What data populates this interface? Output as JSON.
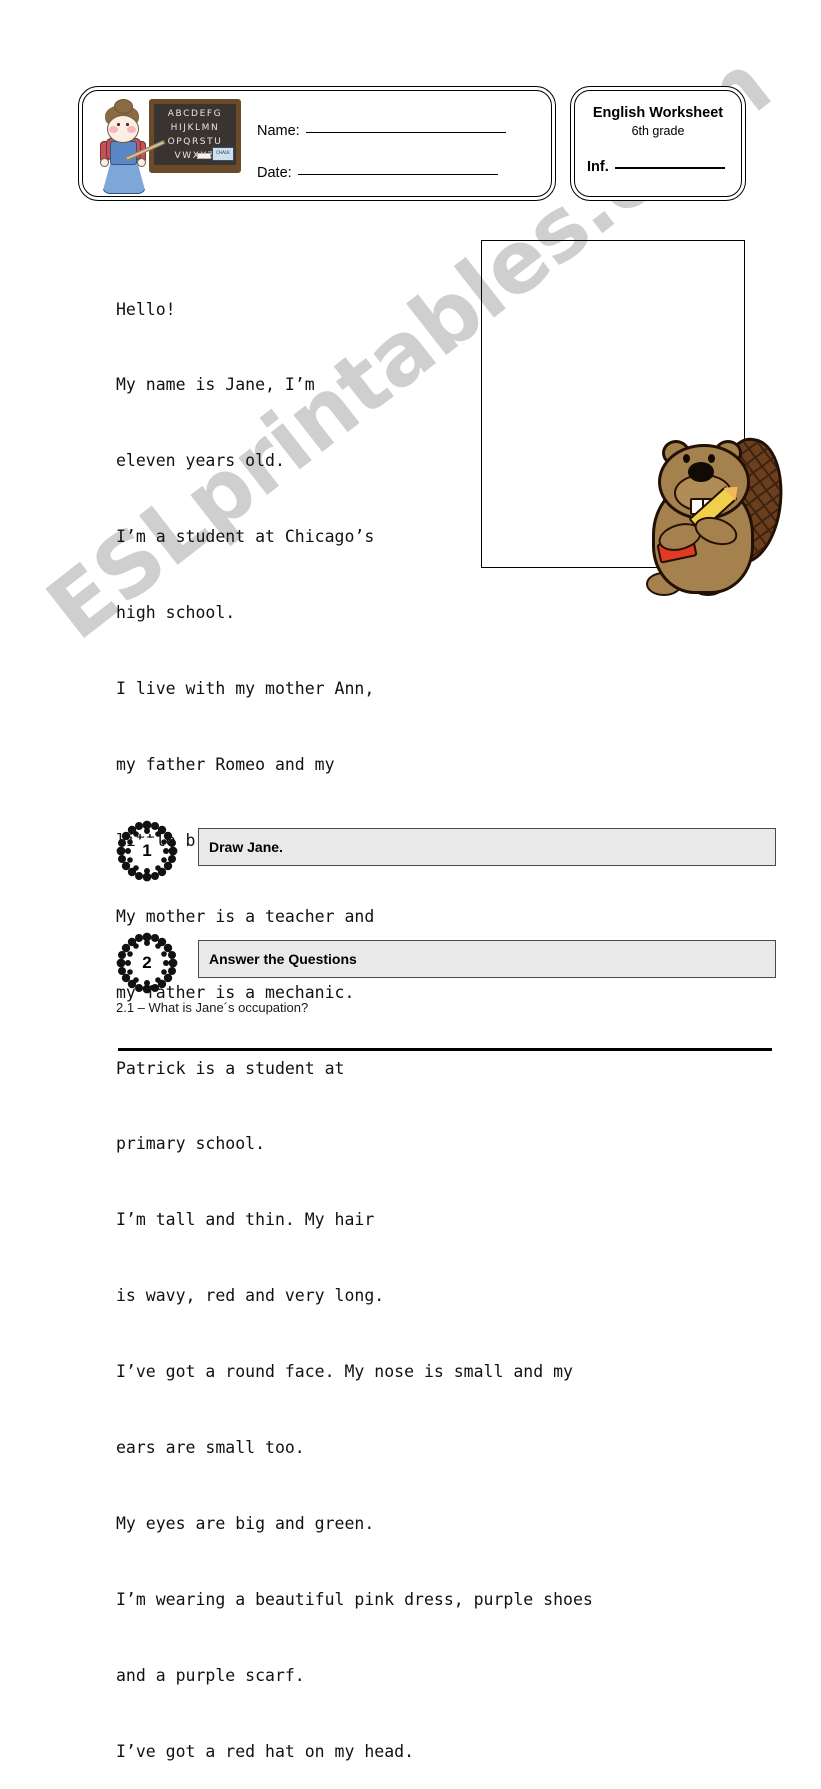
{
  "header": {
    "illustration": {
      "blackboard_rows": [
        "ABCDEFG",
        "HIJKLMN",
        "OPQRSTU",
        "VWXYZ"
      ],
      "chalk_label": "CHALK"
    },
    "name_label": "Name:",
    "date_label": "Date:",
    "title": "English Worksheet",
    "subtitle": "6th grade",
    "inf_label": "Inf."
  },
  "story": {
    "lines_narrow": [
      "Hello!",
      "My name is Jane, I’m",
      "eleven years old.",
      "I’m a student at Chicago’s",
      "high school.",
      "I live with my mother Ann,",
      "my father Romeo and my",
      "little brother Patrick.",
      "My mother is a teacher and",
      "my father is a mechanic.",
      "Patrick is a student at",
      "primary school.",
      "I’m tall and thin. My hair",
      "is wavy, red and very long."
    ],
    "lines_wide": [
      "I’ve got a round face. My nose is small and my",
      "ears are small too.",
      "My eyes are big and green.",
      "I’m wearing a beautiful pink dress, purple shoes",
      "and a purple scarf.",
      "I’ve got a red hat on my head."
    ]
  },
  "exercises": [
    {
      "number": "1",
      "label": "Draw Jane."
    },
    {
      "number": "2",
      "label": "Answer the Questions"
    }
  ],
  "question": "2.1 – What  is Jane´s occupation?",
  "watermark": "ESLprintables.com",
  "colors": {
    "task_bar_fill": "#e9e9e9",
    "task_bar_border": "#4a4a4a",
    "watermark": "#cfcfcf",
    "beaver_body": "#a5814d",
    "beaver_tail": "#6b3f1d",
    "outline": "#000000"
  }
}
